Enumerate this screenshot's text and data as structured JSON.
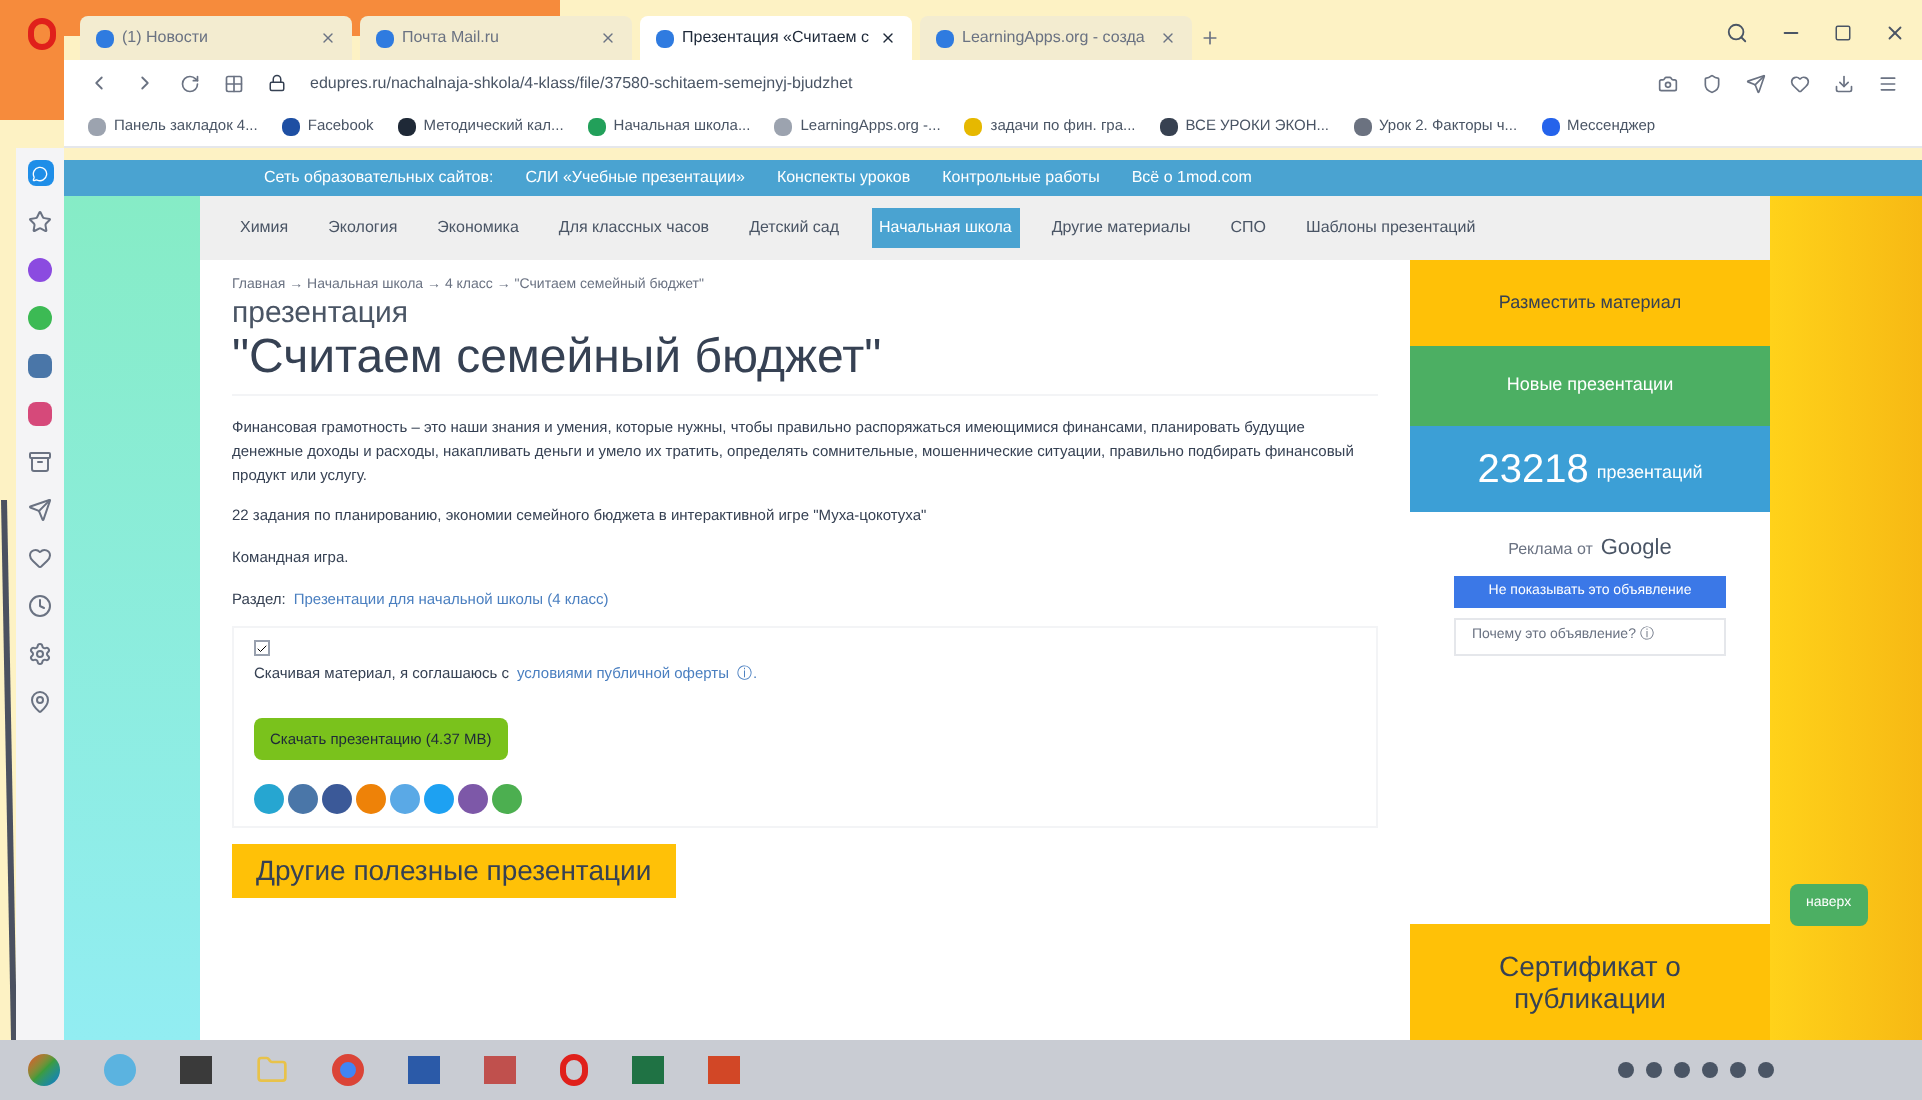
{
  "browser": {
    "tabs": [
      {
        "label": "(1) Новости",
        "selected": false
      },
      {
        "label": "Почта Mail.ru",
        "selected": false
      },
      {
        "label": "Презентация «Считаем с",
        "selected": true
      },
      {
        "label": "LearningApps.org - созда",
        "selected": false
      }
    ],
    "address": "edupres.ru/nachalnaja-shkola/4-klass/file/37580-schitaem-semejnyj-bjudzhet",
    "bookmarks": [
      {
        "label": "Панель закладок 4...",
        "color": "#9ca3af"
      },
      {
        "label": "Facebook",
        "color": "#1e4fa3"
      },
      {
        "label": "Методический кал...",
        "color": "#1f2937"
      },
      {
        "label": "Начальная школа...",
        "color": "#22a05a"
      },
      {
        "label": "LearningApps.org -...",
        "color": "#9ca3af"
      },
      {
        "label": "задачи по фин. гра...",
        "color": "#e6b800"
      },
      {
        "label": "ВСЕ УРОКИ ЭКОН...",
        "color": "#374151"
      },
      {
        "label": "Урок 2. Факторы ч...",
        "color": "#6b7280"
      },
      {
        "label": "Мессенджер",
        "color": "#2563eb"
      }
    ]
  },
  "site": {
    "network_bar": [
      "Сеть образовательных сайтов:",
      "СЛИ «Учебные презентации»",
      "Конспекты уроков",
      "Контрольные работы",
      "Всё о 1mod.com"
    ],
    "nav": [
      {
        "label": "Химия",
        "selected": false
      },
      {
        "label": "Экология",
        "selected": false
      },
      {
        "label": "Экономика",
        "selected": false
      },
      {
        "label": "Для классных часов",
        "selected": false
      },
      {
        "label": "Детский сад",
        "selected": false
      },
      {
        "label": "Начальная школа",
        "selected": true
      },
      {
        "label": "Другие материалы",
        "selected": false
      },
      {
        "label": "СПО",
        "selected": false
      },
      {
        "label": "Шаблоны презентаций",
        "selected": false
      }
    ],
    "breadcrumb": "Главная → Начальная школа → 4 класс → \"Считаем семейный бюджет\"",
    "subtitle": "презентация",
    "title": "\"Считаем семейный бюджет\"",
    "description": "Финансовая грамотность – это наши знания и умения, которые нужны, чтобы правильно распоряжаться имеющимися финансами, планировать будущие денежные доходы и расходы, накапливать деньги и умело их тратить, определять сомнительные, мошеннические ситуации, правильно подбирать финансовый продукт или услугу.",
    "tasks": "22 задания по планированию, экономии семейного бюджета в интерактивной игре \"Муха-цокотуха\"",
    "game_type": "Командная игра.",
    "section_label": "Раздел:",
    "section_link": "Презентации для начальной школы (4 класс)",
    "agree": {
      "checked": true,
      "text": "Скачивая материал, я соглашаюсь с",
      "link": "условиями публичной оферты",
      "info": "ⓘ."
    },
    "download": "Скачать презентацию (4.37 MB)",
    "share": [
      {
        "color": "#26a6d1"
      },
      {
        "color": "#4a76a8"
      },
      {
        "color": "#3b5998"
      },
      {
        "color": "#ee8208"
      },
      {
        "color": "#5aa9e6"
      },
      {
        "color": "#1da1f2"
      },
      {
        "color": "#7d58a8"
      },
      {
        "color": "#4caf50"
      }
    ],
    "other_heading": "Другие полезные презентации",
    "sidebar": {
      "post": "Разместить материал",
      "new": "Новые презентации",
      "count": "23218",
      "count_label": "презентаций",
      "ad_label": "Реклама от",
      "ad_brand": "Google",
      "ad_hide": "Не показывать это объявление",
      "ad_why": "Почему это объявление? ⓘ",
      "certificate": "Сертификат о публикации"
    },
    "up_button": "наверх"
  }
}
